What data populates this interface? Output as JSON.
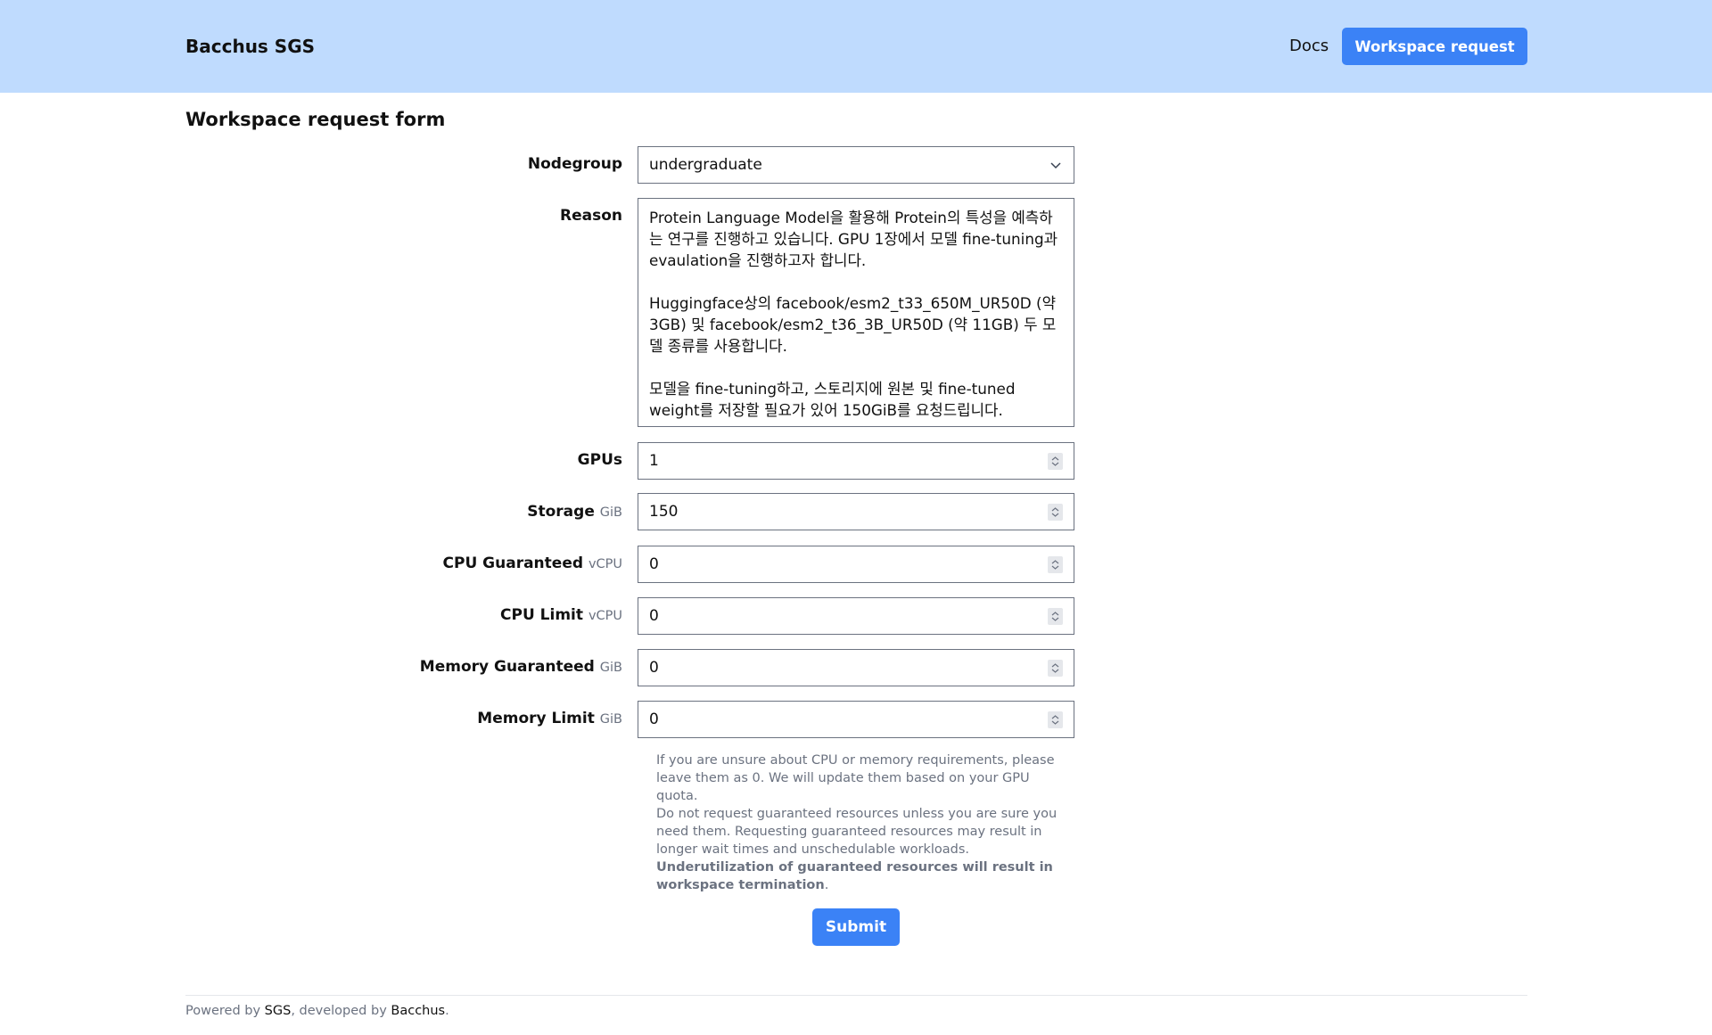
{
  "header": {
    "brand": "Bacchus SGS",
    "docs_label": "Docs",
    "workspace_request_label": "Workspace request"
  },
  "page_title": "Workspace request form",
  "form": {
    "nodegroup": {
      "label": "Nodegroup",
      "value": "undergraduate"
    },
    "reason": {
      "label": "Reason",
      "value": "Protein Language Model을 활용해 Protein의 특성을 예측하는 연구를 진행하고 있습니다. GPU 1장에서 모델 fine-tuning과 evaulation을 진행하고자 합니다.\n\nHuggingface상의 facebook/esm2_t33_650M_UR50D (약 3GB) 및 facebook/esm2_t36_3B_UR50D (약 11GB) 두 모델 종류를 사용합니다.\n\n모델을 fine-tuning하고, 스토리지에 원본 및 fine-tuned weight를 저장할 필요가 있어 150GiB를 요청드립니다."
    },
    "gpus": {
      "label": "GPUs",
      "unit": "",
      "value": "1"
    },
    "storage": {
      "label": "Storage",
      "unit": "GiB",
      "value": "150"
    },
    "cpu_guaranteed": {
      "label": "CPU Guaranteed",
      "unit": "vCPU",
      "value": "0"
    },
    "cpu_limit": {
      "label": "CPU Limit",
      "unit": "vCPU",
      "value": "0"
    },
    "memory_guaranteed": {
      "label": "Memory Guaranteed",
      "unit": "GiB",
      "value": "0"
    },
    "memory_limit": {
      "label": "Memory Limit",
      "unit": "GiB",
      "value": "0"
    },
    "hint": {
      "line1": "If you are unsure about CPU or memory requirements, please leave them as 0. We will update them based on your GPU quota.",
      "line2": "Do not request guaranteed resources unless you are sure you need them. Requesting guaranteed resources may result in longer wait times and unschedulable workloads.",
      "warning_bold": "Underutilization of guaranteed resources will result in workspace termination",
      "warning_end": "."
    },
    "submit_label": "Submit"
  },
  "footer": {
    "powered_by": "Powered by ",
    "sgs_link": "SGS",
    "developed_by": ", developed by ",
    "bacchus_link": "Bacchus",
    "end": "."
  },
  "colors": {
    "header_bg": "#bfdbfe",
    "accent": "#3b82f6"
  }
}
